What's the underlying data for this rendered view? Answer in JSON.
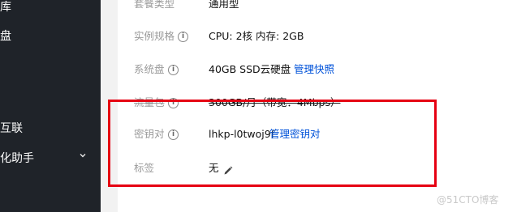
{
  "sidebar": {
    "items": [
      {
        "label": "库"
      },
      {
        "label": "盘"
      },
      {
        "label": "互联"
      },
      {
        "label": "化助手"
      }
    ]
  },
  "details": {
    "rows": [
      {
        "label": "套餐类型",
        "value": "通用型",
        "has_info": false,
        "link": ""
      },
      {
        "label": "实例规格",
        "value": "CPU: 2核 内存: 2GB",
        "has_info": true,
        "link": ""
      },
      {
        "label": "系统盘",
        "value": "40GB SSD云硬盘",
        "has_info": true,
        "link": "管理快照"
      },
      {
        "label": "流量包",
        "value": "300GB/月（带宽：4Mbps）",
        "has_info": true,
        "link": ""
      },
      {
        "label": "密钥对",
        "value": "lhkp-l0twoj9f",
        "has_info": true,
        "link": "管理密钥对"
      },
      {
        "label": "标签",
        "value": "无",
        "has_info": false,
        "link": ""
      }
    ]
  },
  "watermark": "@51CTO博客",
  "colors": {
    "sidebar_bg": "#1f2329",
    "link": "#0052d9",
    "highlight_box": "#e60012"
  }
}
